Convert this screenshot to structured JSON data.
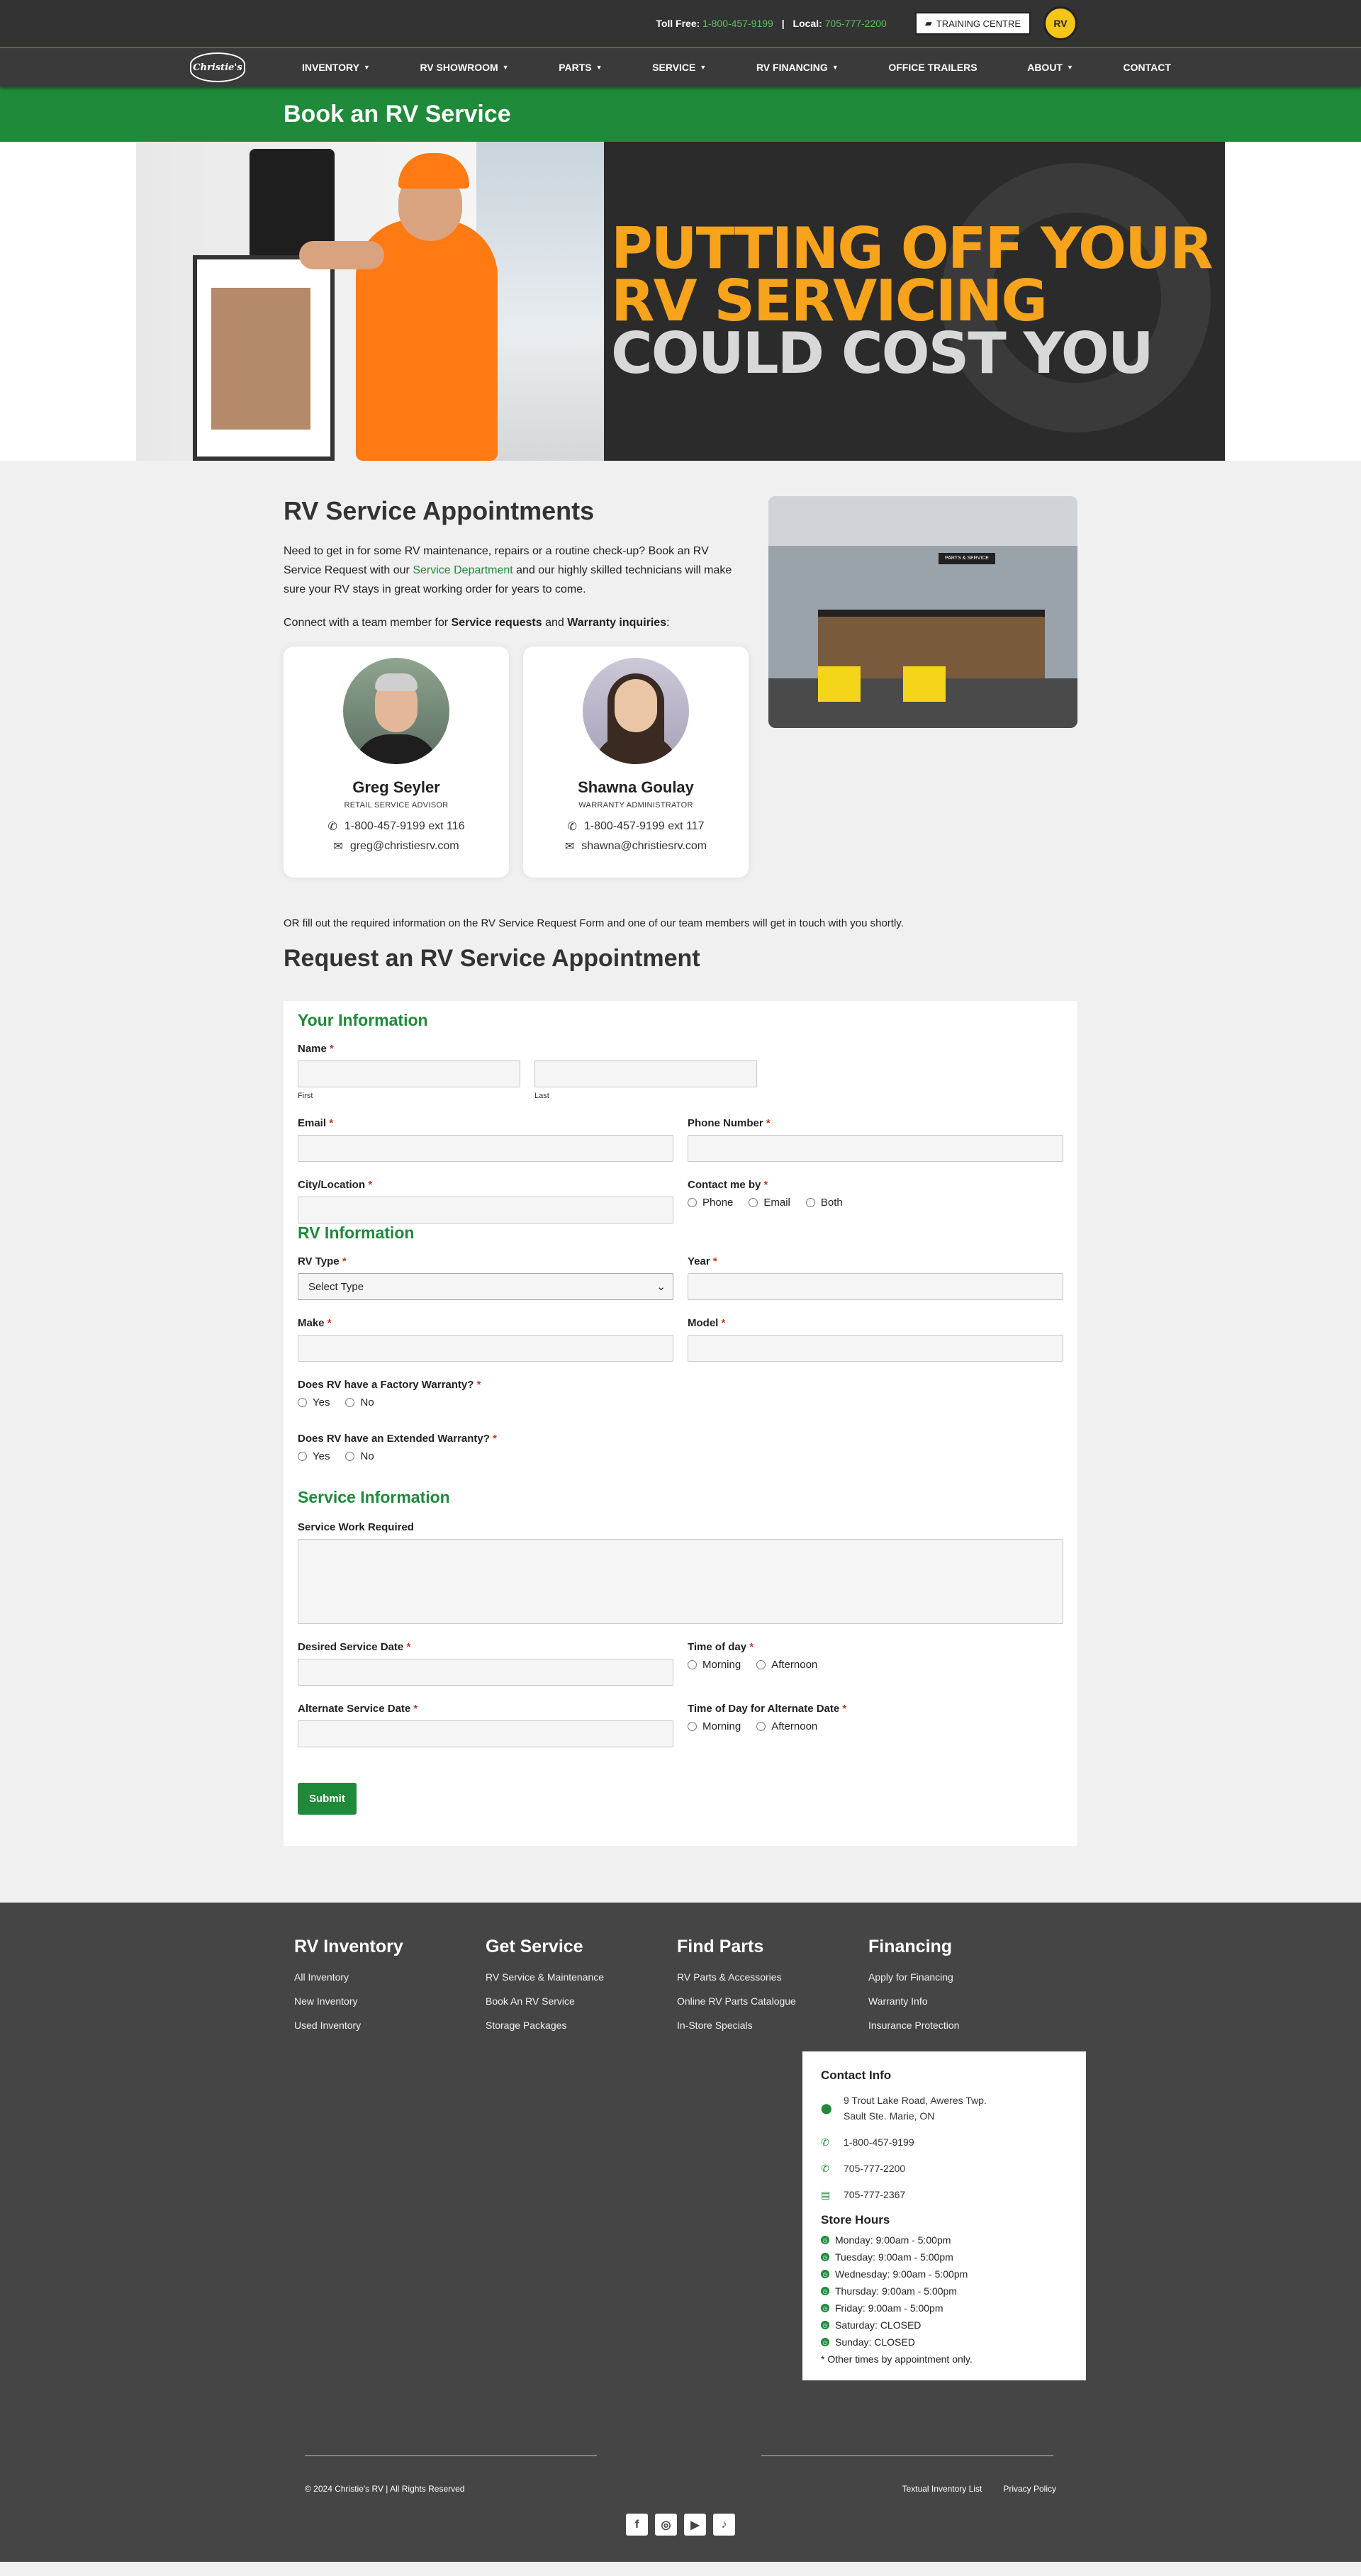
{
  "topbar": {
    "toll_free_label": "Toll Free:",
    "toll_free_number": "1-800-457-9199",
    "separator": "|",
    "local_label": "Local:",
    "local_number": "705-777-2200",
    "training_label": "TRAINING CENTRE",
    "badge_text": "RV"
  },
  "nav": {
    "logo_text": "Christie's",
    "items": [
      {
        "label": "INVENTORY",
        "has_caret": true
      },
      {
        "label": "RV SHOWROOM",
        "has_caret": true
      },
      {
        "label": "PARTS",
        "has_caret": true
      },
      {
        "label": "SERVICE",
        "has_caret": true
      },
      {
        "label": "RV FINANCING",
        "has_caret": true
      },
      {
        "label": "OFFICE TRAILERS",
        "has_caret": false
      },
      {
        "label": "ABOUT",
        "has_caret": true
      },
      {
        "label": "CONTACT",
        "has_caret": false
      }
    ]
  },
  "page_title": "Book an RV Service",
  "hero": {
    "line1": "PUTTING OFF YOUR",
    "line2": "RV SERVICING",
    "line3": "COULD COST YOU"
  },
  "intro": {
    "heading": "RV Service Appointments",
    "para_before_link": "Need to get in for some RV maintenance, repairs or a routine check-up? Book an RV Service Request with our ",
    "link_text": "Service Department",
    "para_after_link": " and our highly skilled technicians will make sure your RV stays in great working order for years to come.",
    "connect_before": "Connect with a team member for ",
    "connect_bold1": "Service requests",
    "connect_and": " and ",
    "connect_bold2": "Warranty inquiries",
    "connect_end": ":",
    "store_sign": "PARTS & SERVICE"
  },
  "contacts": [
    {
      "name": "Greg Seyler",
      "role": "RETAIL SERVICE ADVISOR",
      "phone": "1-800-457-9199 ext 116",
      "email": "greg@christiesrv.com"
    },
    {
      "name": "Shawna Goulay",
      "role": "WARRANTY ADMINISTRATOR",
      "phone": "1-800-457-9199 ext 117",
      "email": "shawna@christiesrv.com"
    }
  ],
  "or_text": "OR fill out the required information on the RV Service Request Form and one of our team members will get in touch with you shortly.",
  "request_title": "Request an RV Service Appointment",
  "form": {
    "section_your_info": "Your Information",
    "name_label": "Name",
    "first_label": "First",
    "last_label": "Last",
    "email_label": "Email",
    "phone_label": "Phone Number",
    "city_label": "City/Location",
    "contact_by_label": "Contact me by",
    "contact_options": [
      "Phone",
      "Email",
      "Both"
    ],
    "section_rv_info": "RV Information",
    "rv_type_label": "RV Type",
    "rv_type_selected": "Select Type",
    "year_label": "Year",
    "make_label": "Make",
    "model_label": "Model",
    "factory_warranty_label": "Does RV have a Factory Warranty?",
    "extended_warranty_label": "Does RV have an Extended Warranty?",
    "yes_no": [
      "Yes",
      "No"
    ],
    "section_service_info": "Service Information",
    "service_work_label": "Service Work Required",
    "desired_date_label": "Desired Service Date",
    "time_of_day_label": "Time of day",
    "time_options": [
      "Morning",
      "Afternoon"
    ],
    "alt_date_label": "Alternate Service Date",
    "alt_time_label": "Time of Day for Alternate Date",
    "required_mark": "*",
    "submit_label": "Submit"
  },
  "footer": {
    "columns": [
      {
        "title": "RV Inventory",
        "links": [
          "All Inventory",
          "New Inventory",
          "Used Inventory"
        ]
      },
      {
        "title": "Get Service",
        "links": [
          "RV Service & Maintenance",
          "Book An RV Service",
          "Storage Packages"
        ]
      },
      {
        "title": "Find Parts",
        "links": [
          "RV Parts & Accessories",
          "Online RV Parts Catalogue",
          "In-Store Specials"
        ]
      },
      {
        "title": "Financing",
        "links": [
          "Apply for Financing",
          "Warranty Info",
          "Insurance Protection"
        ]
      }
    ],
    "contact_title": "Contact Info",
    "address_line1": "9 Trout Lake Road, Aweres Twp.",
    "address_line2": "Sault Ste. Marie, ON",
    "phone1": "1-800-457-9199",
    "phone2": "705-777-2200",
    "fax": "705-777-2367",
    "hours_title": "Store Hours",
    "hours": [
      "Monday: 9:00am - 5:00pm",
      "Tuesday: 9:00am - 5:00pm",
      "Wednesday: 9:00am - 5:00pm",
      "Thursday: 9:00am - 5:00pm",
      "Friday: 9:00am - 5:00pm",
      "Saturday: CLOSED",
      "Sunday: CLOSED"
    ],
    "other_times": "* Other times by appointment only.",
    "copyright": "© 2024 Christie's RV | All Rights Reserved",
    "bottom_links": [
      "Textual Inventory List",
      "Privacy Policy"
    ],
    "social": [
      "facebook-icon",
      "instagram-icon",
      "youtube-icon",
      "tiktok-icon"
    ]
  },
  "colors": {
    "brand_green": "#1f8a3a",
    "dark_bar": "#333333",
    "footer_bg": "#454545",
    "hero_orange": "#f7a31c"
  }
}
